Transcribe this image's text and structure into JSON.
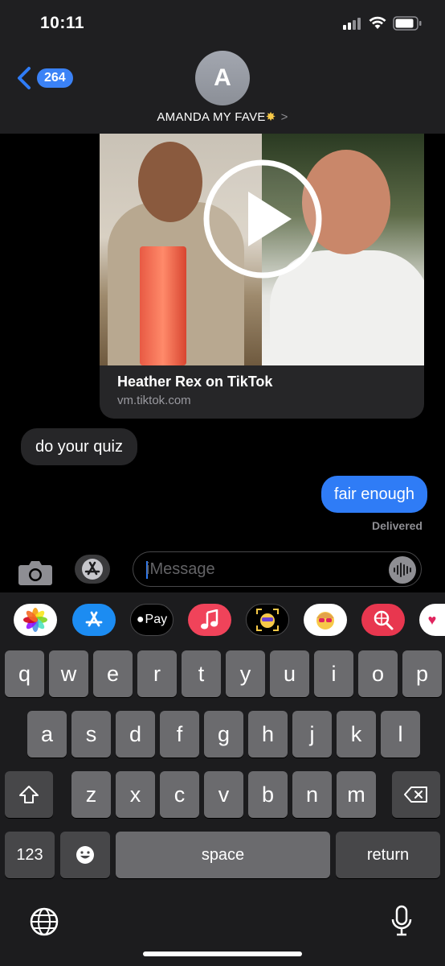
{
  "status_bar": {
    "time": "10:11"
  },
  "header": {
    "back_count": "264",
    "avatar_initial": "A",
    "contact_name": "AMANDA MY FAVE",
    "contact_chevron": ">"
  },
  "link_preview": {
    "title": "Heather Rex on TikTok",
    "url": "vm.tiktok.com"
  },
  "messages": {
    "incoming": "do your quiz",
    "outgoing": "fair enough",
    "status": "Delivered"
  },
  "compose": {
    "placeholder": "iMessage"
  },
  "app_tray": {
    "apple_pay_label": "Pay"
  },
  "keyboard": {
    "row1": [
      "q",
      "w",
      "e",
      "r",
      "t",
      "y",
      "u",
      "i",
      "o",
      "p"
    ],
    "row2": [
      "a",
      "s",
      "d",
      "f",
      "g",
      "h",
      "j",
      "k",
      "l"
    ],
    "row3": [
      "z",
      "x",
      "c",
      "v",
      "b",
      "n",
      "m"
    ],
    "numbers_label": "123",
    "space_label": "space",
    "return_label": "return"
  },
  "colors": {
    "imessage_blue": "#2f7cf6",
    "bubble_gray": "#262628",
    "key_gray": "#6b6b6e",
    "key_dark": "#474749"
  }
}
